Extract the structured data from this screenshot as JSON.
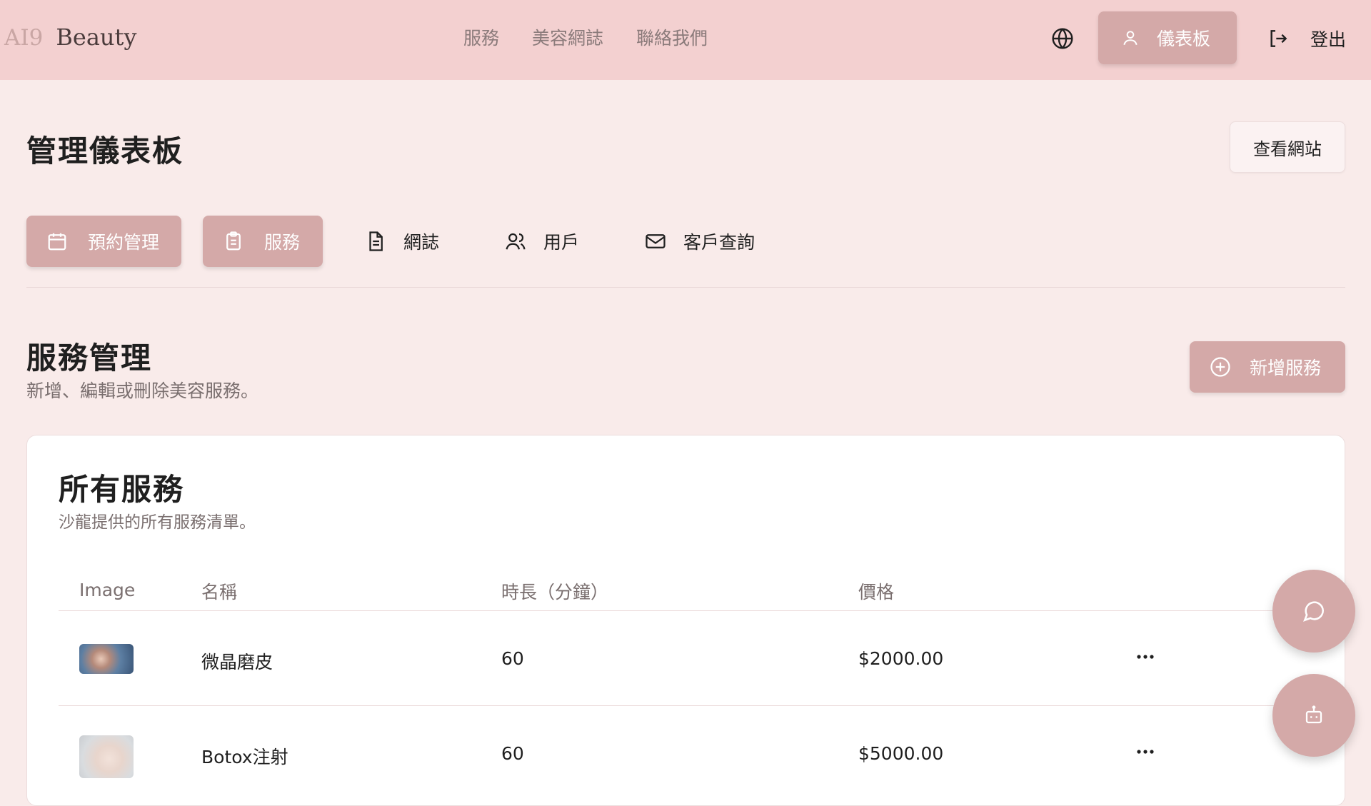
{
  "header": {
    "logo_mark": "AI9",
    "logo_text": "Beauty",
    "nav": [
      "服務",
      "美容網誌",
      "聯絡我們"
    ],
    "dashboard_label": "儀表板",
    "logout_label": "登出"
  },
  "page": {
    "title": "管理儀表板",
    "view_site_label": "查看網站"
  },
  "tabs": [
    {
      "label": "預約管理",
      "icon": "calendar-icon",
      "active": true
    },
    {
      "label": "服務",
      "icon": "clipboard-icon",
      "active": true
    },
    {
      "label": "網誌",
      "icon": "document-icon",
      "active": false
    },
    {
      "label": "用戶",
      "icon": "users-icon",
      "active": false
    },
    {
      "label": "客戶查詢",
      "icon": "mail-icon",
      "active": false
    }
  ],
  "section": {
    "title": "服務管理",
    "subtitle": "新增、編輯或刪除美容服務。",
    "add_label": "新增服務"
  },
  "card": {
    "title": "所有服務",
    "subtitle": "沙龍提供的所有服務清單。",
    "columns": [
      "Image",
      "名稱",
      "時長（分鐘）",
      "價格"
    ],
    "rows": [
      {
        "name": "微晶磨皮",
        "duration": "60",
        "price": "$2000.00"
      },
      {
        "name": "Botox注射",
        "duration": "60",
        "price": "$5000.00"
      }
    ]
  },
  "colors": {
    "header_bg": "#f3d0d0",
    "page_bg": "#f9ebea",
    "accent": "#d4a9a8"
  }
}
